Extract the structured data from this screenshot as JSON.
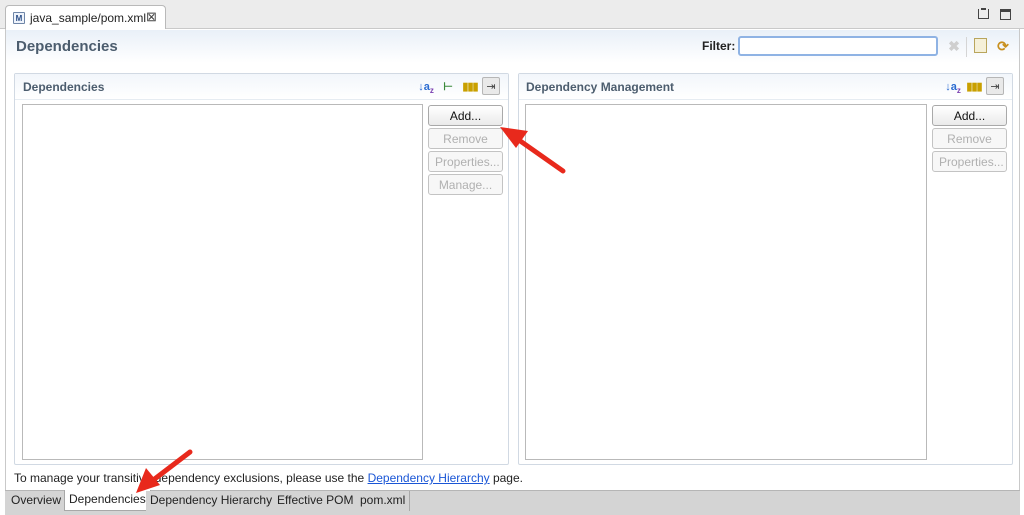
{
  "editor": {
    "tab_title": "java_sample/pom.xml",
    "tab_icon_letter": "M"
  },
  "header": {
    "page_title": "Dependencies",
    "filter_label": "Filter:",
    "filter_value": ""
  },
  "dependencies": {
    "title": "Dependencies",
    "buttons": {
      "add": "Add...",
      "remove": "Remove",
      "properties": "Properties...",
      "manage": "Manage..."
    }
  },
  "dependency_management": {
    "title": "Dependency Management",
    "buttons": {
      "add": "Add...",
      "remove": "Remove",
      "properties": "Properties..."
    }
  },
  "hint": {
    "before": "To manage your transitive dependency exclusions, please use the ",
    "link": "Dependency Hierarchy",
    "after": " page."
  },
  "bottom_tabs": [
    "Overview",
    "Dependencies",
    "Dependency Hierarchy",
    "Effective POM",
    "pom.xml"
  ],
  "active_tab": "Dependencies",
  "colors": {
    "annotation_arrow": "#e8291c",
    "link": "#1a56d6",
    "section_title": "#4c5d6e"
  }
}
